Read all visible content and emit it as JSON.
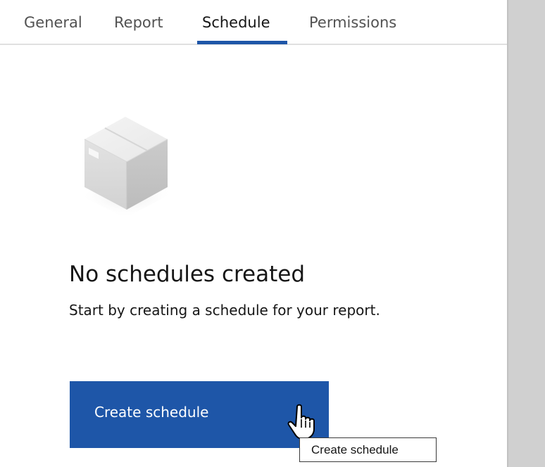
{
  "tabs": [
    {
      "label": "General",
      "active": false
    },
    {
      "label": "Report",
      "active": false
    },
    {
      "label": "Schedule",
      "active": true
    },
    {
      "label": "Permissions",
      "active": false
    }
  ],
  "illustration": {
    "icon": "empty-box-icon"
  },
  "empty_state": {
    "title": "No schedules created",
    "description": "Start by creating a schedule for your report."
  },
  "actions": {
    "create_label": "Create schedule"
  },
  "tooltip": {
    "text": "Create schedule"
  },
  "colors": {
    "accent": "#1e56a8",
    "tab_divider": "#e0e0e0",
    "scroll_rail": "#d0d0d0"
  },
  "cursor": {
    "icon": "hand-pointer-icon"
  }
}
